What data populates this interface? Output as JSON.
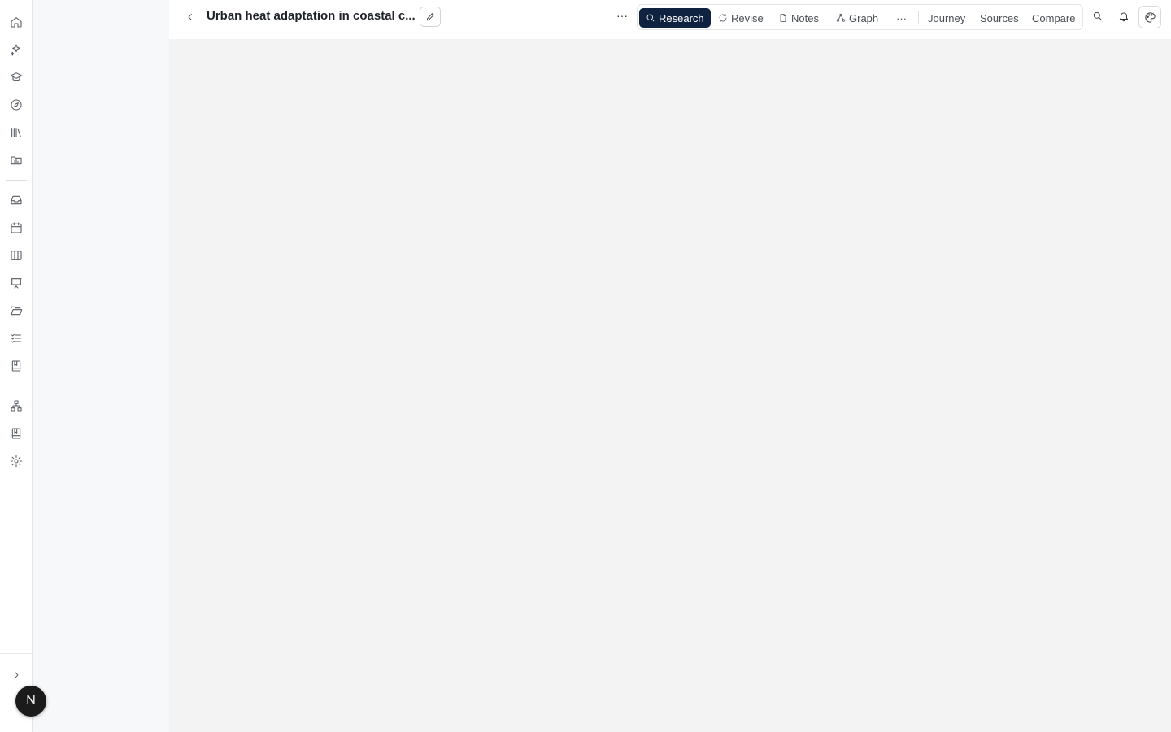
{
  "header": {
    "title": "Urban heat adaptation in coastal c...",
    "more_label": "···"
  },
  "tabs": [
    {
      "label": "Research",
      "icon": "search-icon",
      "active": true
    },
    {
      "label": "Revise",
      "icon": "refresh-icon",
      "active": false
    },
    {
      "label": "Notes",
      "icon": "file-icon",
      "active": false
    },
    {
      "label": "Graph",
      "icon": "graph-icon",
      "active": false
    },
    {
      "label": "···",
      "icon": "more-icon",
      "active": false
    },
    {
      "label": "Journey",
      "active": false
    },
    {
      "label": "Sources",
      "active": false
    },
    {
      "label": "Compare",
      "active": false
    }
  ],
  "rail": {
    "icons": [
      "home-icon",
      "sparkles-icon",
      "graduation-cap-icon",
      "compass-icon",
      "library-icon",
      "folder-chart-icon",
      "inbox-icon",
      "calendar-icon",
      "columns-icon",
      "presentation-icon",
      "folder-open-icon",
      "checklist-icon",
      "notebook-icon",
      "sitemap-icon",
      "book-icon",
      "settings-icon"
    ]
  },
  "user": {
    "avatar_initial": "N"
  },
  "colors": {
    "active_tab": "#0f2340",
    "main_bg": "#f3f3f3",
    "side_panel_bg": "#f7f8f9"
  }
}
